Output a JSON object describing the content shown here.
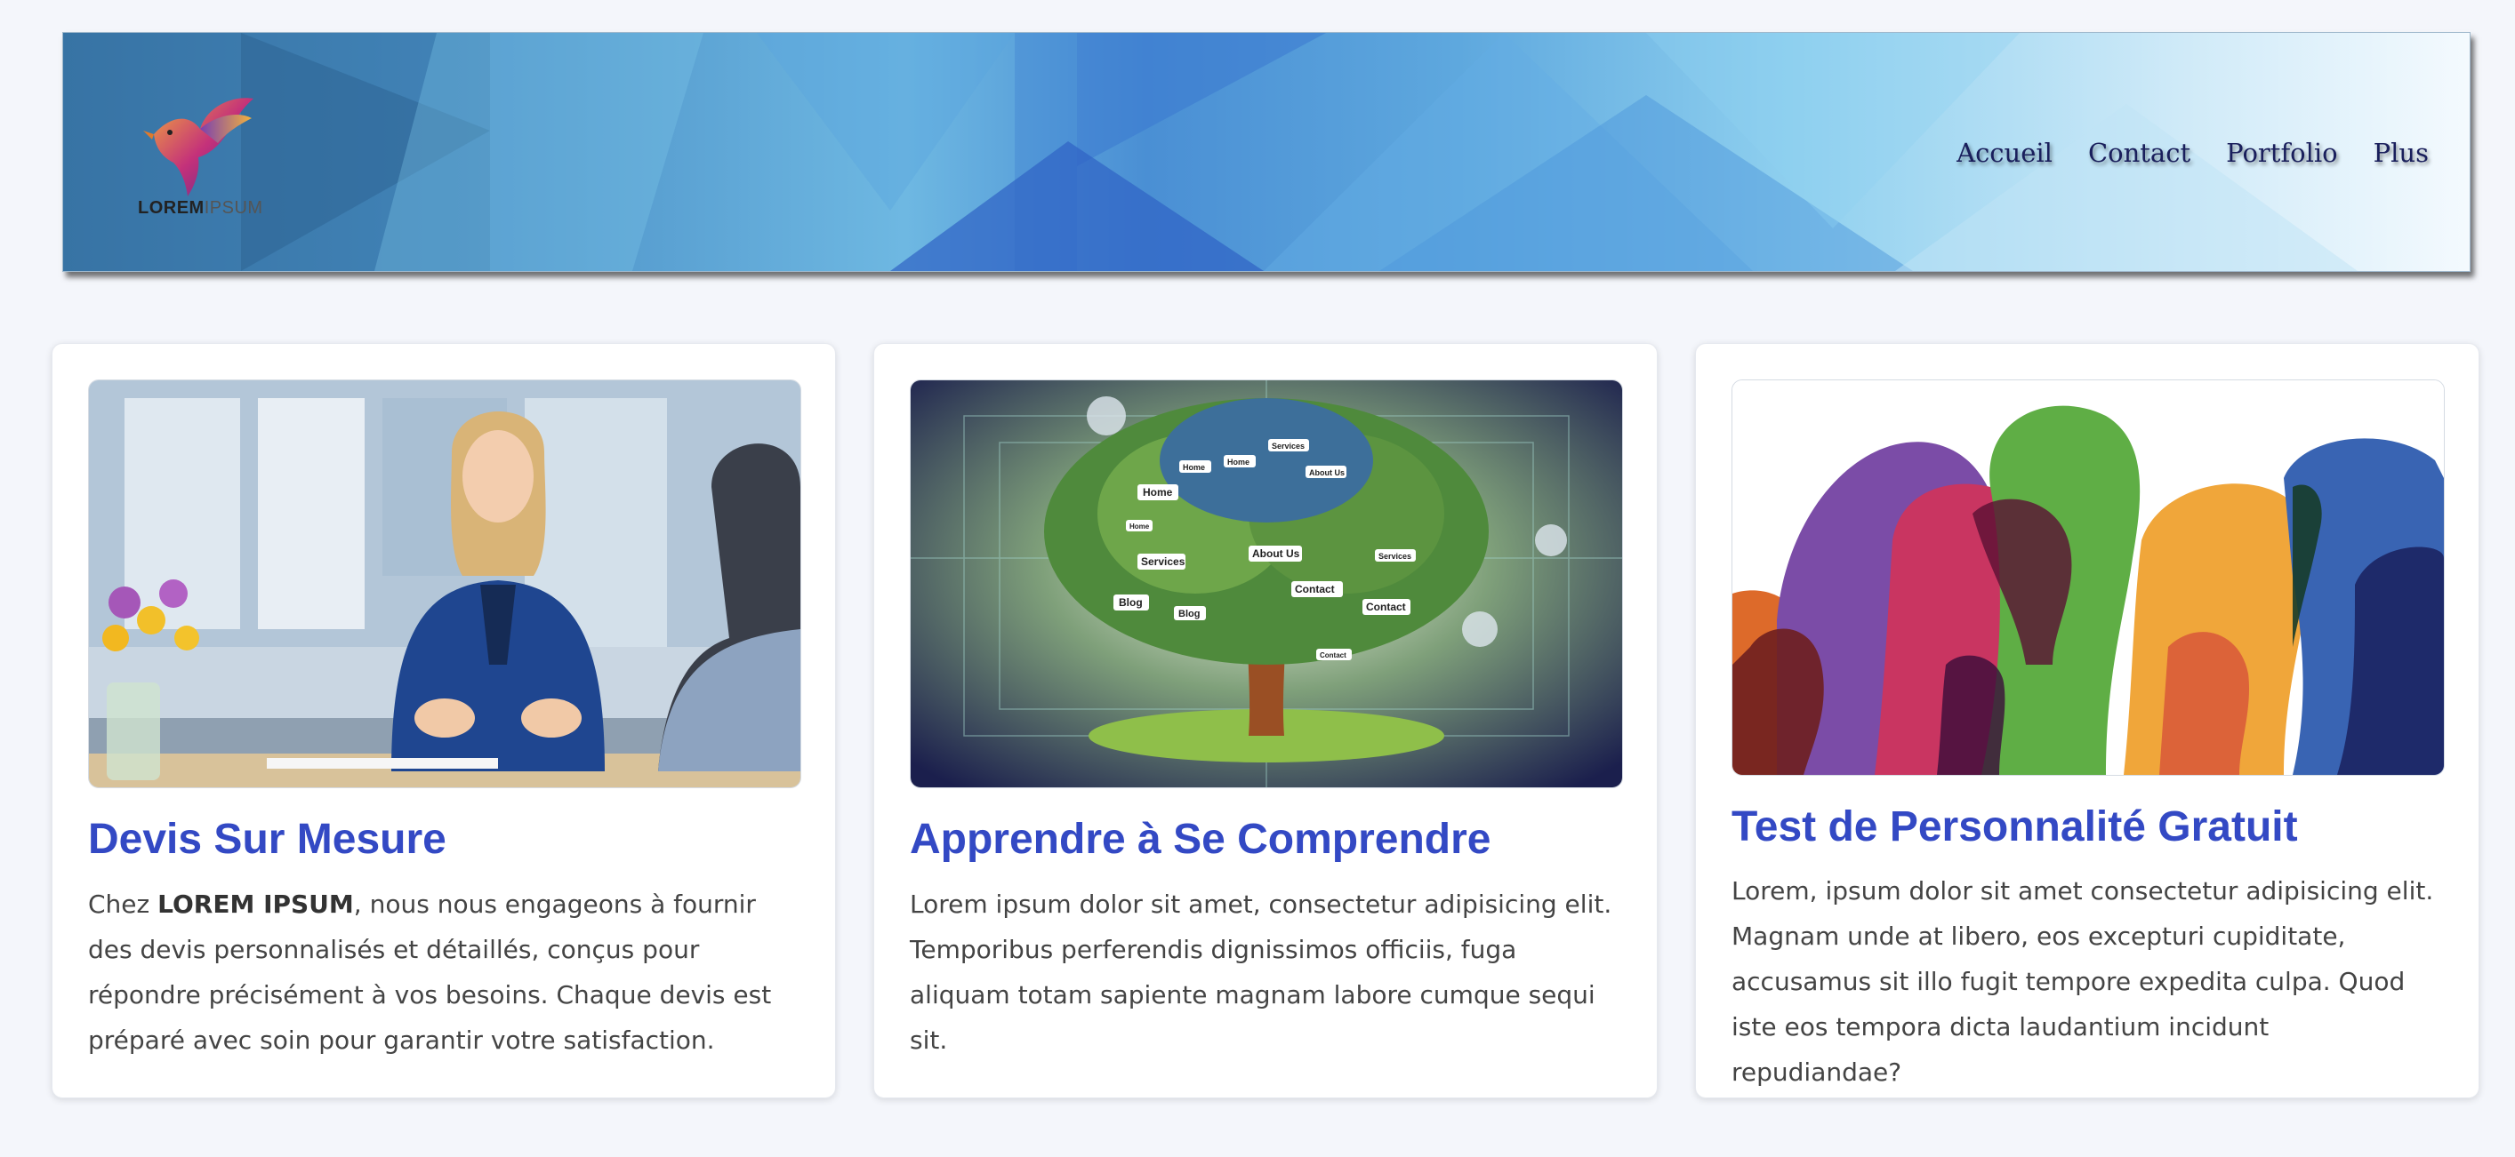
{
  "header": {
    "logo_text_bold": "LOREM",
    "logo_text_light": "IPSUM",
    "nav": [
      "Accueil",
      "Contact",
      "Portfolio",
      "Plus"
    ]
  },
  "cards": [
    {
      "image": "office-meeting-photo",
      "title": "Devis Sur Mesure",
      "text_prefix": "Chez ",
      "text_brand": "LOREM IPSUM",
      "text_suffix": ", nous nous engageons à fournir des devis personnalisés et détaillés, conçus pour répondre précisément à vos besoins. Chaque devis est préparé avec soin pour garantir votre satisfaction."
    },
    {
      "image": "website-tree-illustration",
      "tree_labels": [
        "Home",
        "Home",
        "Home",
        "Services",
        "About Us",
        "Home",
        "Services",
        "About Us",
        "Services",
        "Blog",
        "Blog",
        "Contact",
        "Contact",
        "Contact"
      ],
      "title": "Apprendre à Se Comprendre",
      "text": "Lorem ipsum dolor sit amet, consectetur adipisicing elit. Temporibus perferendis dignissimos officiis, fuga aliquam totam sapiente magnam labore cumque sequi sit."
    },
    {
      "image": "colorful-head-silhouettes",
      "title": "Test de Personnalité Gratuit",
      "text": "Lorem, ipsum dolor sit amet consectetur adipisicing elit. Magnam unde at libero, eos excepturi cupiditate, accusamus sit illo fugit tempore expedita culpa. Quod iste eos tempora dicta laudantium incidunt repudiandae?"
    }
  ],
  "colors": {
    "background": "#f4f6fb",
    "card_title": "#3349c4",
    "nav_text": "#1a1f5c",
    "body_text": "#444444"
  }
}
